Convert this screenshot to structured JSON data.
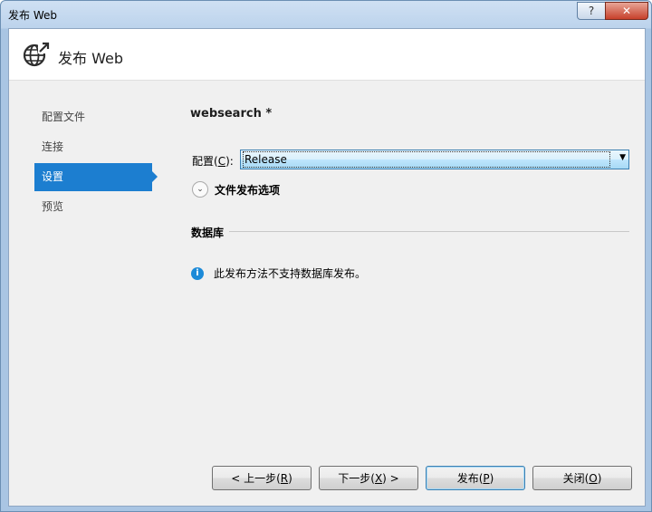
{
  "window": {
    "title": "发布 Web",
    "help_label": "?",
    "close_label": "✕"
  },
  "header": {
    "icon": "globe-publish-icon",
    "title": "发布 Web"
  },
  "nav": {
    "items": [
      {
        "label": "配置文件",
        "active": false
      },
      {
        "label": "连接",
        "active": false
      },
      {
        "label": "设置",
        "active": true
      },
      {
        "label": "预览",
        "active": false
      }
    ]
  },
  "settings": {
    "project_name": "websearch *",
    "config_label_pre": "配置(",
    "config_label_key": "C",
    "config_label_post": "):",
    "config_value": "Release",
    "file_options_label": "文件发布选项",
    "database_title": "数据库",
    "database_info": "此发布方法不支持数据库发布。"
  },
  "buttons": {
    "prev": {
      "pre": "< 上一步(",
      "key": "R",
      "post": ")"
    },
    "next": {
      "pre": "下一步(",
      "key": "X",
      "post": ") >"
    },
    "publish": {
      "pre": "发布(",
      "key": "P",
      "post": ")"
    },
    "close": {
      "pre": "关闭(",
      "key": "O",
      "post": ")"
    }
  },
  "colors": {
    "accent": "#1c7ed0",
    "info": "#1c8ad8"
  }
}
